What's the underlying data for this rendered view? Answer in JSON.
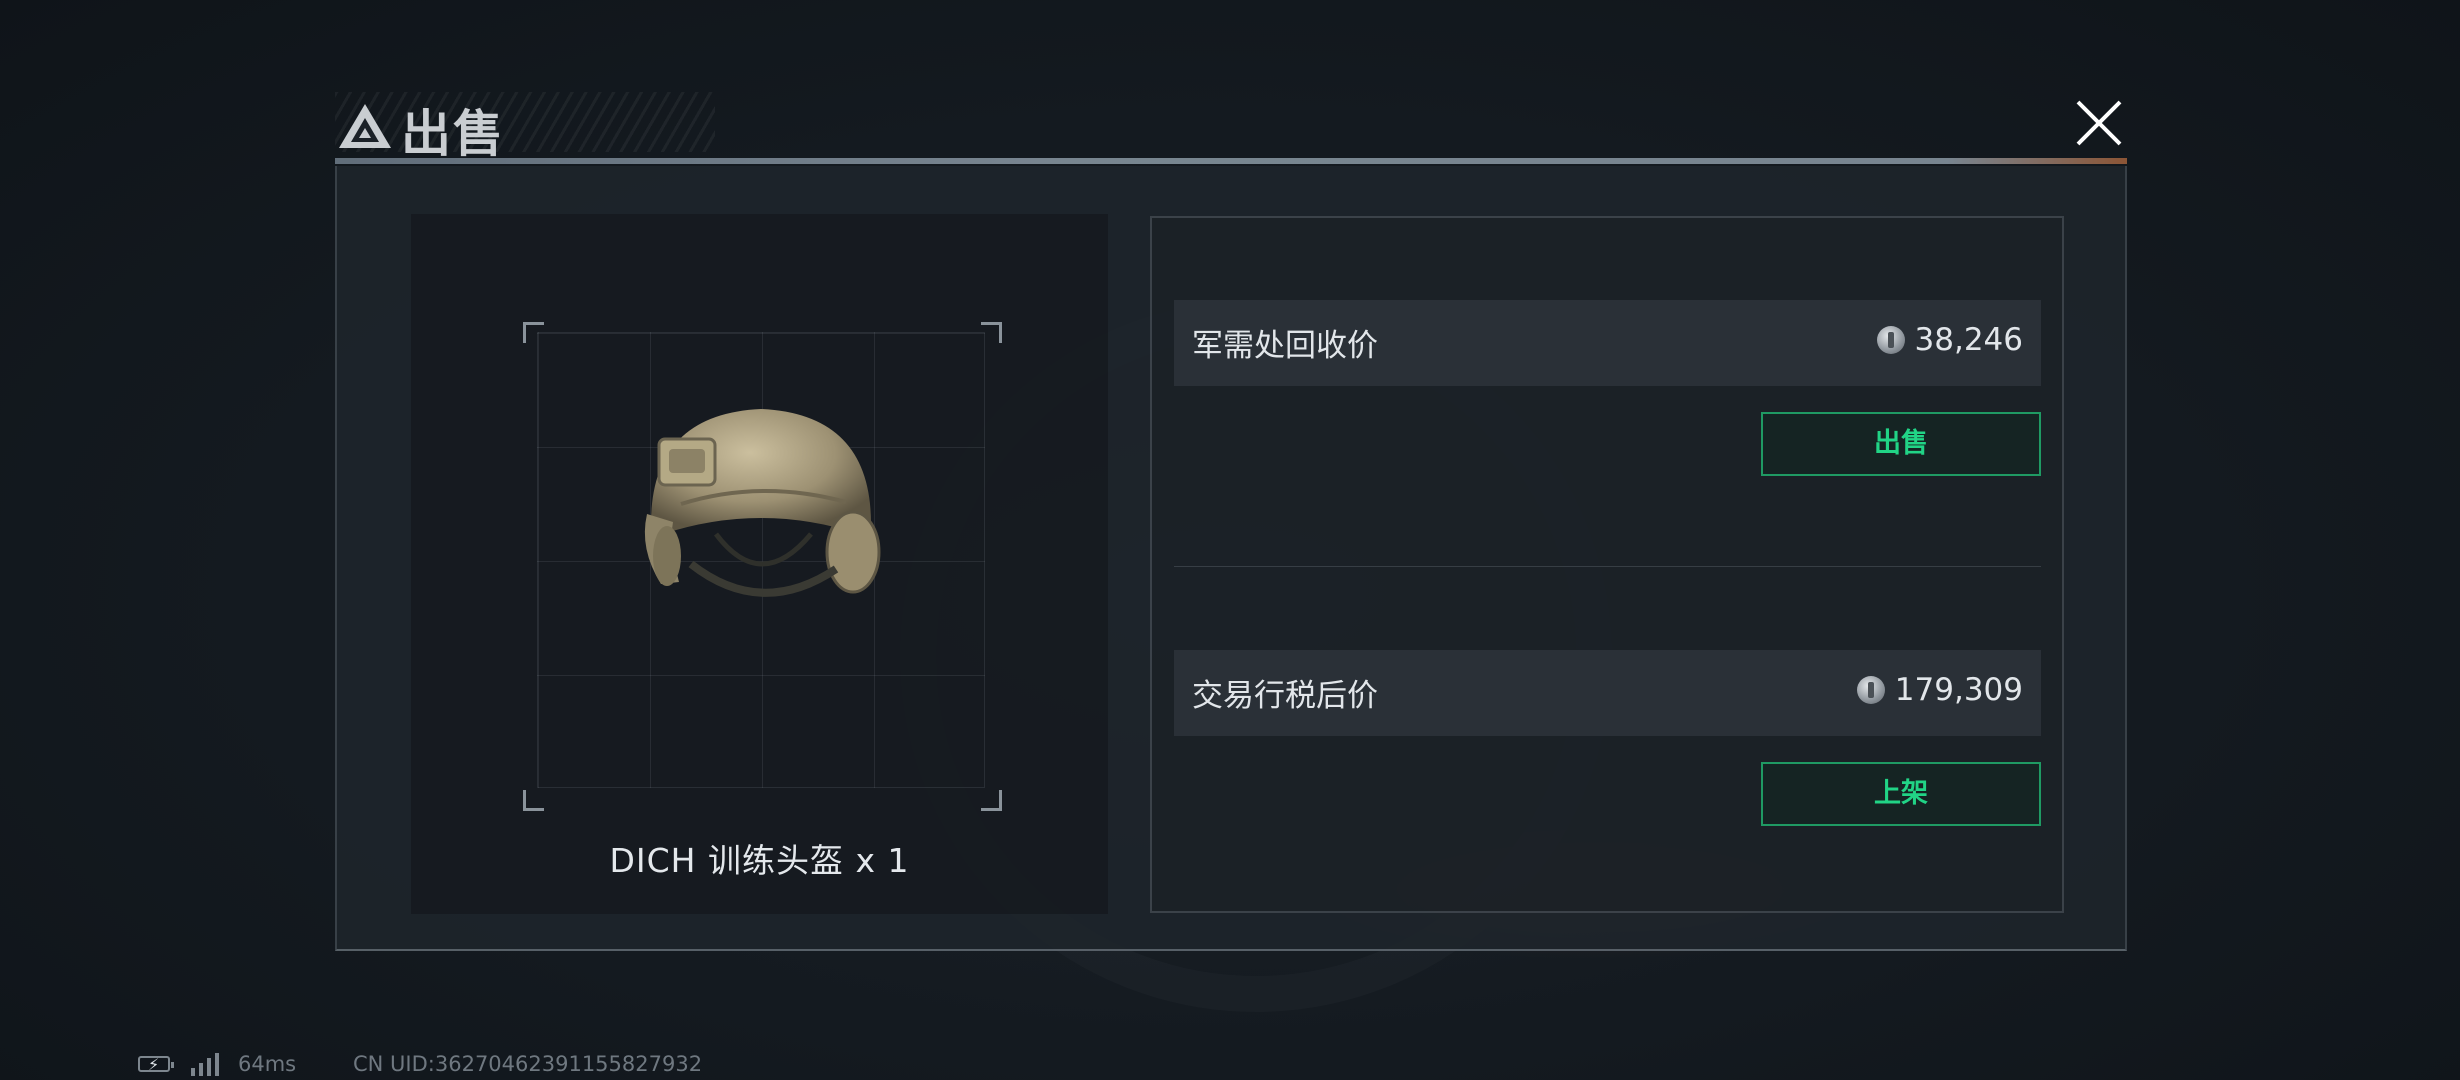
{
  "dialog": {
    "title": "出售",
    "close_icon": "close-icon",
    "logo_icon": "triangle-logo-icon"
  },
  "item": {
    "name": "DICH 训练头盔 x 1",
    "image_icon": "helmet-icon"
  },
  "recycle": {
    "label": "军需处回收价",
    "value": "38,246",
    "button_label": "出售"
  },
  "market": {
    "label": "交易行税后价",
    "value": "179,309",
    "button_label": "上架"
  },
  "status_bar": {
    "latency": "64ms",
    "uid": "CN UID:36270462391155827932"
  },
  "colors": {
    "accent_green": "#21d486",
    "button_border": "#1f9a63"
  }
}
